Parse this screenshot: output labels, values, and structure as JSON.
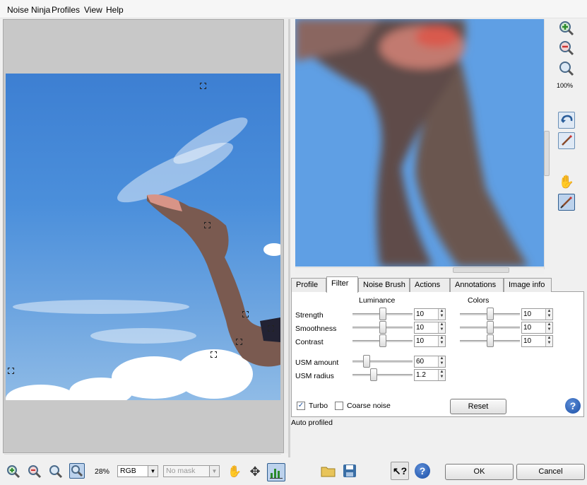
{
  "menu": {
    "items": [
      "Noise Ninja",
      "Profiles",
      "View",
      "Help"
    ]
  },
  "right_toolbar": {
    "icons": [
      "zoom-in-icon",
      "zoom-out-icon",
      "zoom-fit-icon",
      "undo-brush-icon",
      "brush-pen-icon",
      "hand-icon",
      "noise-brush-icon"
    ],
    "zoom_label": "100%"
  },
  "tabs": [
    "Profile",
    "Filter",
    "Noise Brush",
    "Actions",
    "Annotations",
    "Image info"
  ],
  "active_tab": "Filter",
  "filter": {
    "luminance_header": "Luminance",
    "colors_header": "Colors",
    "rows": [
      {
        "label": "Strength",
        "lum": "10",
        "col": "10",
        "lum_level": 0.5,
        "col_level": 0.5
      },
      {
        "label": "Smoothness",
        "lum": "10",
        "col": "10",
        "lum_level": 0.5,
        "col_level": 0.5
      },
      {
        "label": "Contrast",
        "lum": "10",
        "col": "10",
        "lum_level": 0.5,
        "col_level": 0.5
      }
    ],
    "usm": [
      {
        "label": "USM amount",
        "value": "60",
        "level": 0.2
      },
      {
        "label": "USM radius",
        "value": "1.2",
        "level": 0.33
      }
    ],
    "turbo_label": "Turbo",
    "turbo_checked": true,
    "coarse_label": "Coarse noise",
    "coarse_checked": false,
    "reset_label": "Reset",
    "help": "?"
  },
  "status": "Auto profiled",
  "bottom": {
    "zoom": "28%",
    "color_mode": "RGB",
    "mask": "No mask",
    "ok_label": "OK",
    "cancel_label": "Cancel",
    "help": "?"
  }
}
